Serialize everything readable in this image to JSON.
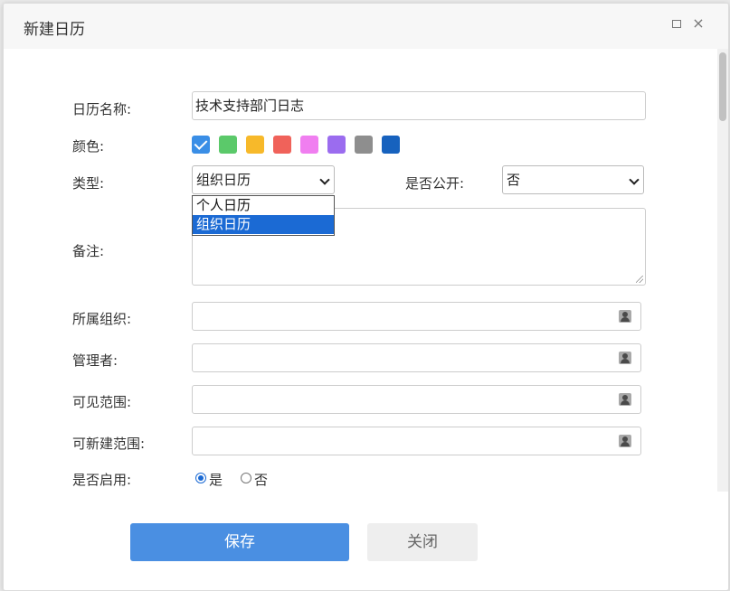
{
  "dialog": {
    "title": "新建日历",
    "maximize_icon": "maximize-icon",
    "close_icon": "close-icon",
    "close_glyph": "×"
  },
  "form": {
    "name_label": "日历名称:",
    "name_value": "技术支持部门日志",
    "color_label": "颜色:",
    "colors": [
      "#3a8ee6",
      "#5bc96a",
      "#f7b92a",
      "#f0625a",
      "#f07ef0",
      "#9b6cef",
      "#8e8e8e",
      "#1762be"
    ],
    "selected_color_index": 0,
    "type_label": "类型:",
    "type_value": "组织日历",
    "type_options": [
      "个人日历",
      "组织日历"
    ],
    "public_label": "是否公开:",
    "public_value": "否",
    "note_label": "备注:",
    "org_label": "所属组织:",
    "manager_label": "管理者:",
    "visible_label": "可见范围:",
    "creatable_label": "可新建范围:",
    "picker_icon": "user-picker-icon",
    "enabled_label": "是否启用:",
    "enabled_yes": "是",
    "enabled_no": "否",
    "enabled_value": "是"
  },
  "buttons": {
    "save": "保存",
    "close": "关闭"
  }
}
